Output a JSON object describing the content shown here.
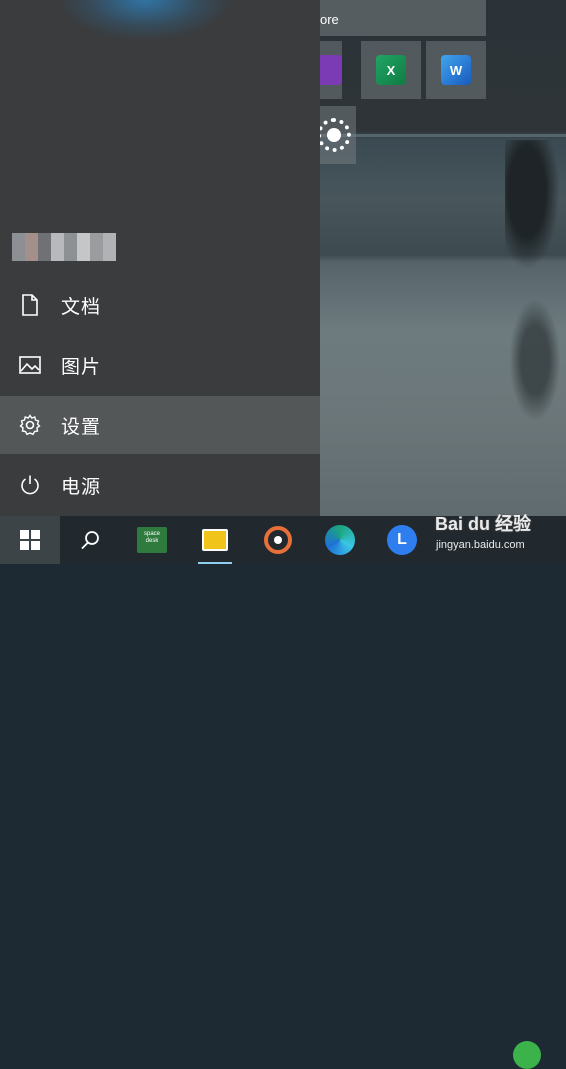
{
  "tiles": {
    "store_label": "ore",
    "excel_letter": "X",
    "word_letter": "W"
  },
  "menu": {
    "items": [
      {
        "label": "文档",
        "icon": "document-icon"
      },
      {
        "label": "图片",
        "icon": "pictures-icon"
      },
      {
        "label": "设置",
        "icon": "settings-gear-icon",
        "highlighted": true
      },
      {
        "label": "电源",
        "icon": "power-icon"
      }
    ]
  },
  "taskbar": {
    "space_desk_text": "space desk",
    "l_app_letter": "L"
  },
  "watermark": {
    "brand": "Bai du 经验",
    "url": "jingyan.baidu.com"
  },
  "colors": {
    "panel": "#3a3c3d",
    "highlight": "#545758",
    "taskbar": "#22292e",
    "excel": "#107c41",
    "word": "#185abd",
    "onenote": "#7b3bb5"
  }
}
